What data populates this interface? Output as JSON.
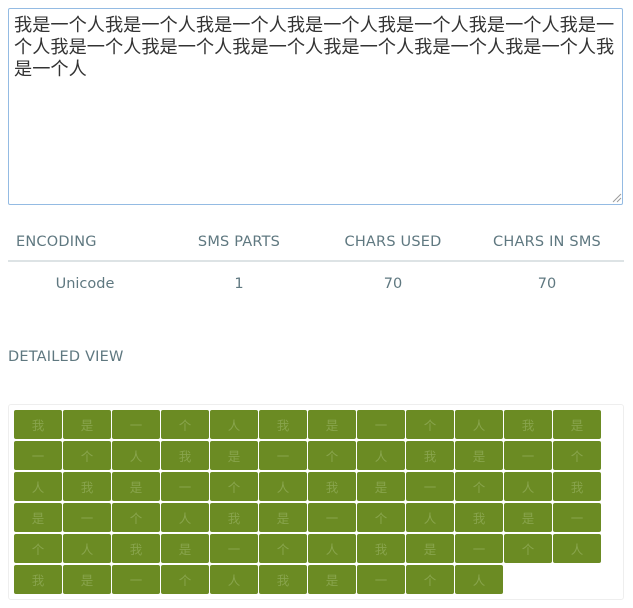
{
  "message": {
    "text": "我是一个人我是一个人我是一个人我是一个人我是一个人我是一个人我是一个人我是一个人我是一个人我是一个人我是一个人我是一个人我是一个人我是一个人"
  },
  "stats": {
    "headers": {
      "encoding": "ENCODING",
      "sms_parts": "SMS PARTS",
      "chars_used": "CHARS USED",
      "chars_in_sms": "CHARS IN SMS"
    },
    "values": {
      "encoding": "Unicode",
      "sms_parts": "1",
      "chars_used": "70",
      "chars_in_sms": "70"
    }
  },
  "detailed_view": {
    "heading": "DETAILED VIEW",
    "chars": [
      "我",
      "是",
      "一",
      "个",
      "人",
      "我",
      "是",
      "一",
      "个",
      "人",
      "我",
      "是",
      "一",
      "个",
      "人",
      "我",
      "是",
      "一",
      "个",
      "人",
      "我",
      "是",
      "一",
      "个",
      "人",
      "我",
      "是",
      "一",
      "个",
      "人",
      "我",
      "是",
      "一",
      "个",
      "人",
      "我",
      "是",
      "一",
      "个",
      "人",
      "我",
      "是",
      "一",
      "个",
      "人",
      "我",
      "是",
      "一",
      "个",
      "人",
      "我",
      "是",
      "一",
      "个",
      "人",
      "我",
      "是",
      "一",
      "个",
      "人",
      "我",
      "是",
      "一",
      "个",
      "人",
      "我",
      "是",
      "一",
      "个",
      "人"
    ]
  },
  "colors": {
    "cell_background": "#6b8b23",
    "cell_text": "#88a44c",
    "focus_border": "#94bbe3",
    "label_text": "#5f7880"
  }
}
